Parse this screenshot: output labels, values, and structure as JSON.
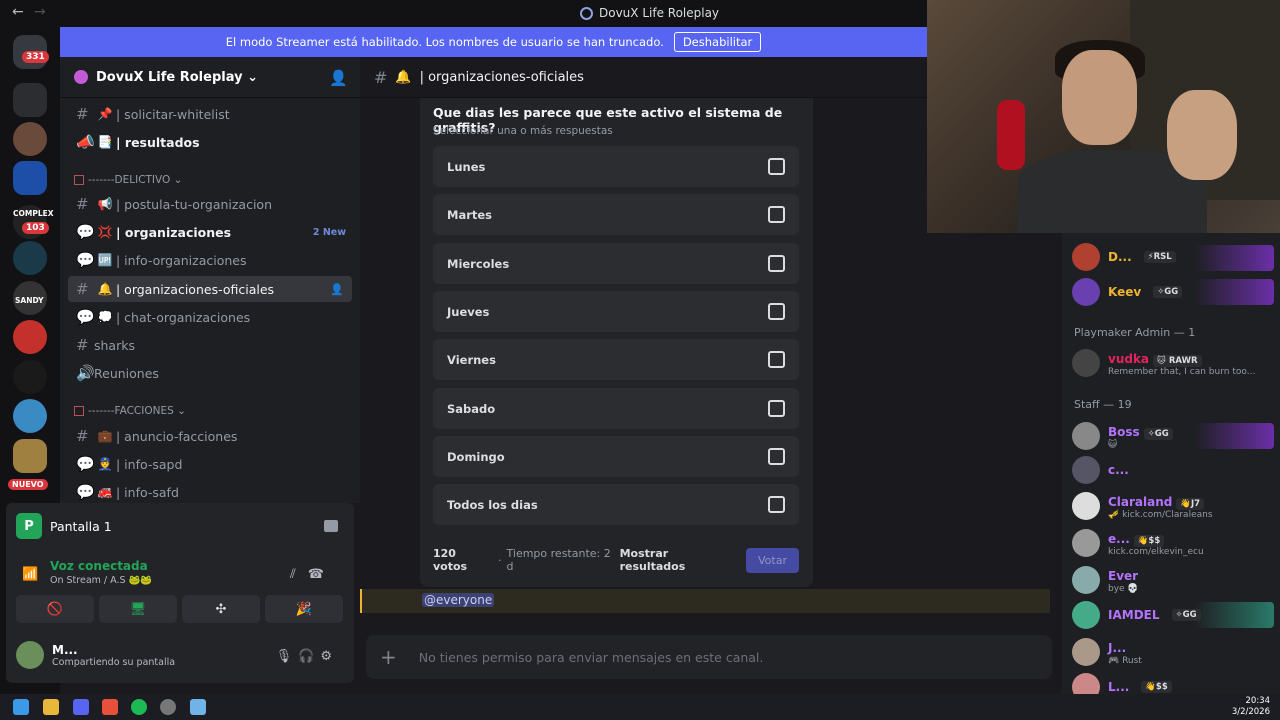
{
  "window": {
    "title": "DovuX Life Roleplay",
    "back": "←",
    "forward": "→"
  },
  "guilds": {
    "badges": [
      "331",
      "103"
    ],
    "labels": [
      "COMPLEX",
      "SANDY",
      "NUEVO"
    ]
  },
  "banner": {
    "text": "El modo Streamer está habilitado. Los nombres de usuario se han truncado.",
    "button": "Deshabilitar"
  },
  "server": {
    "name": "DovuX Life Roleplay ⌄"
  },
  "channels": {
    "items": [
      {
        "name": "| solicitar-whitelist",
        "emoji": "📌"
      },
      {
        "name": "| resultados",
        "emoji": "📑"
      },
      {
        "name": "| postula-tu-organizacion",
        "emoji": "📢"
      },
      {
        "name": "| organizaciones",
        "emoji": "💢",
        "badge": "2 New"
      },
      {
        "name": "| info-organizaciones",
        "emoji": "🆙"
      },
      {
        "name": "| organizaciones-oficiales",
        "emoji": "🔔"
      },
      {
        "name": "| chat-organizaciones",
        "emoji": "💭"
      },
      {
        "name": "sharks",
        "emoji": ""
      },
      {
        "name": "Reuniones",
        "emoji": ""
      },
      {
        "name": "| anuncio-facciones",
        "emoji": "💼"
      },
      {
        "name": "| info-sapd",
        "emoji": "👮"
      },
      {
        "name": "| info-safd",
        "emoji": "🚒"
      }
    ],
    "categories": [
      "-------DELICTIVO ⌄",
      "-------FACCIONES ⌄"
    ]
  },
  "voice": {
    "stream_title": "Pantalla 1",
    "stream_icon": "P",
    "status": "Voz conectada",
    "status_sub": "On Stream / A.S 🐸🐸"
  },
  "user": {
    "name": "M...",
    "status": "Compartiendo su pantalla"
  },
  "channel_header": {
    "name": "| organizaciones-oficiales"
  },
  "poll": {
    "question": "Que dias les parece que este activo el sistema de graffitis?",
    "subtitle": "Seleccionar una o más respuestas",
    "options": [
      "Lunes",
      "Martes",
      "Miercoles",
      "Jueves",
      "Viernes",
      "Sabado",
      "Domingo",
      "Todos los dias"
    ],
    "votes": "120 votos",
    "separator": "·",
    "time_left": "Tiempo restante: 2 d",
    "show_results": "Mostrar resultados",
    "vote_button": "Votar"
  },
  "mention": "@everyone",
  "message_box": {
    "placeholder": "No tienes permiso para enviar mensajes en este canal."
  },
  "members": {
    "groups": [
      {
        "header": "Playmaker Admin — 1"
      },
      {
        "header": "Staff — 19"
      }
    ],
    "list": [
      {
        "name": "D...",
        "tag": "⚡RSL",
        "sub": "",
        "color": "#f0b232",
        "avatar": "#b04030"
      },
      {
        "name": "Keev",
        "tag": "✧GG",
        "sub": "",
        "color": "#f0b232",
        "avatar": "#6a3fb0"
      },
      {
        "name": "vudka",
        "tag": "🐱 RAWR",
        "sub": "Remember that, I can burn too...",
        "color": "#e0245e",
        "avatar": "#444"
      },
      {
        "name": "Boss",
        "tag": "✧GG",
        "sub": "😺",
        "color": "#b273ff",
        "avatar": "#888"
      },
      {
        "name": "c...",
        "tag": "",
        "sub": "",
        "color": "#b273ff",
        "avatar": "#556"
      },
      {
        "name": "Claraland",
        "tag": "👋J7",
        "sub": "🎺 kick.com/Claraleans",
        "color": "#b273ff",
        "avatar": "#ddd"
      },
      {
        "name": "e...",
        "tag": "👋$$",
        "sub": "kick.com/elkevin_ecu",
        "color": "#b273ff",
        "avatar": "#999"
      },
      {
        "name": "Ever",
        "tag": "",
        "sub": "bye 💀",
        "color": "#b273ff",
        "avatar": "#8aa"
      },
      {
        "name": "IAMDEL",
        "tag": "✧GG",
        "sub": "",
        "color": "#b273ff",
        "avatar": "#4a8"
      },
      {
        "name": "J...",
        "tag": "",
        "sub": "🎮 Rust",
        "color": "#b273ff",
        "avatar": "#a98"
      },
      {
        "name": "L...",
        "tag": "👋$$",
        "sub": "",
        "color": "#b273ff",
        "avatar": "#c88"
      }
    ]
  },
  "taskbar": {
    "time": "20:34",
    "date": "3/2/2026"
  },
  "colors": {
    "accent": "#5865f2",
    "online": "#23a559",
    "mention": "#f0b232"
  }
}
